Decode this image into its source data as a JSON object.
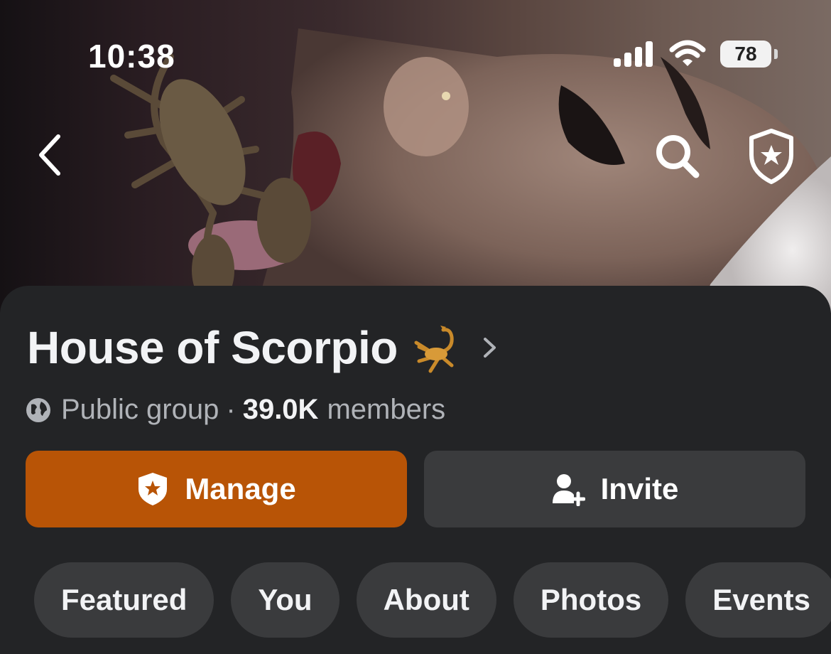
{
  "status_bar": {
    "time": "10:38",
    "battery": "78"
  },
  "group": {
    "name": "House of Scorpio",
    "privacy": "Public group",
    "separator": "·",
    "member_count": "39.0K",
    "member_label": "members"
  },
  "actions": {
    "manage_label": "Manage",
    "invite_label": "Invite"
  },
  "tabs": [
    {
      "label": "Featured"
    },
    {
      "label": "You"
    },
    {
      "label": "About"
    },
    {
      "label": "Photos"
    },
    {
      "label": "Events"
    }
  ],
  "colors": {
    "accent": "#b85406",
    "card_bg": "#232426",
    "pill_bg": "#3a3b3d"
  },
  "icons": [
    "back-icon",
    "search-icon",
    "admin-shield-icon",
    "scorpion-emoji-icon",
    "chevron-right-icon",
    "globe-icon",
    "shield-star-icon",
    "person-add-icon"
  ]
}
